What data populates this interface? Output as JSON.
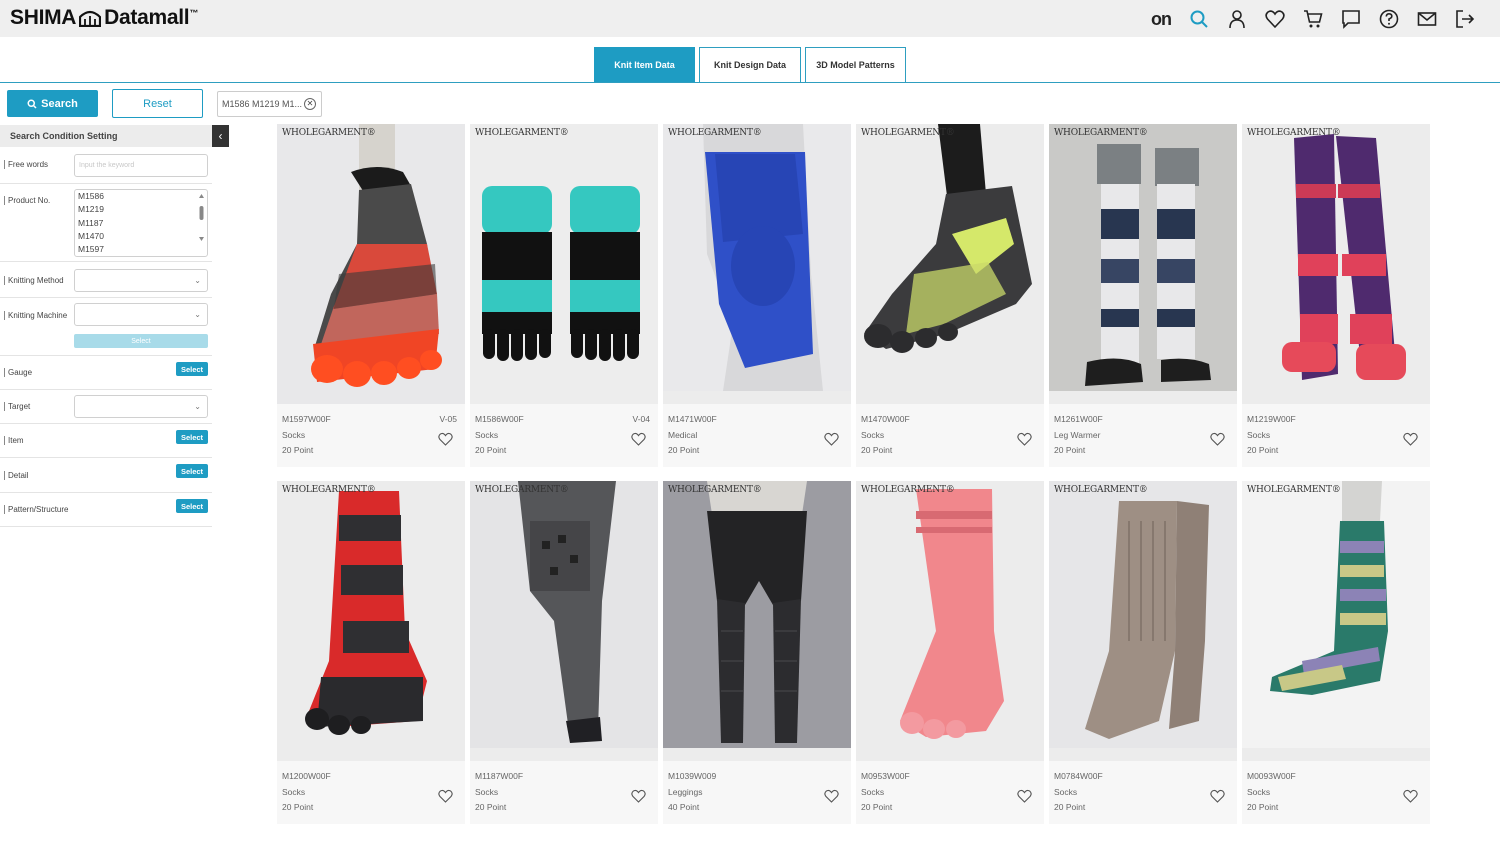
{
  "brand": {
    "name_left": "SHIMA",
    "name_right": "Datamall",
    "trademark": "™"
  },
  "header_icons": [
    "on-logo",
    "search-icon",
    "user-icon",
    "heart-icon",
    "cart-icon",
    "chat-icon",
    "help-icon",
    "mail-icon",
    "logout-icon"
  ],
  "header": {
    "on_label": "on"
  },
  "accent_color": "#1e9cc3",
  "tabs": [
    {
      "label": "Knit Item Data",
      "active": true
    },
    {
      "label": "Knit Design Data",
      "active": false
    },
    {
      "label": "3D Model Patterns",
      "active": false
    }
  ],
  "controls": {
    "search_label": "Search",
    "reset_label": "Reset",
    "chip_label": "M1586 M1219 M1..."
  },
  "sidebar": {
    "heading": "Search Condition Setting",
    "free_words": {
      "label": "Free words",
      "placeholder": "Input the keyword"
    },
    "product_no": {
      "label": "Product No.",
      "values": [
        "M1586",
        "M1219",
        "M1187",
        "M1470",
        "M1597"
      ]
    },
    "knitting_method": {
      "label": "Knitting Method"
    },
    "knitting_machine": {
      "label": "Knitting Machine",
      "select_label": "Select"
    },
    "gauge": {
      "label": "Gauge",
      "select_label": "Select"
    },
    "target": {
      "label": "Target"
    },
    "item": {
      "label": "Item",
      "select_label": "Select"
    },
    "detail": {
      "label": "Detail",
      "select_label": "Select"
    },
    "pattern": {
      "label": "Pattern/Structure",
      "select_label": "Select"
    }
  },
  "product_brand": "WHOLEGARMENT®",
  "products": [
    {
      "code": "M1597W00F",
      "category": "Socks",
      "gauge": "20 Point",
      "version": "V-05"
    },
    {
      "code": "M1586W00F",
      "category": "Socks",
      "gauge": "20 Point",
      "version": "V-04"
    },
    {
      "code": "M1471W00F",
      "category": "Medical",
      "gauge": "20 Point",
      "version": ""
    },
    {
      "code": "M1470W00F",
      "category": "Socks",
      "gauge": "20 Point",
      "version": ""
    },
    {
      "code": "M1261W00F",
      "category": "Leg Warmer",
      "gauge": "20 Point",
      "version": ""
    },
    {
      "code": "M1219W00F",
      "category": "Socks",
      "gauge": "20 Point",
      "version": ""
    },
    {
      "code": "M1200W00F",
      "category": "Socks",
      "gauge": "20 Point",
      "version": ""
    },
    {
      "code": "M1187W00F",
      "category": "Socks",
      "gauge": "20 Point",
      "version": ""
    },
    {
      "code": "M1039W009",
      "category": "Leggings",
      "gauge": "40 Point",
      "version": ""
    },
    {
      "code": "M0953W00F",
      "category": "Socks",
      "gauge": "20 Point",
      "version": ""
    },
    {
      "code": "M0784W00F",
      "category": "Socks",
      "gauge": "20 Point",
      "version": ""
    },
    {
      "code": "M0093W00F",
      "category": "Socks",
      "gauge": "20 Point",
      "version": ""
    }
  ]
}
